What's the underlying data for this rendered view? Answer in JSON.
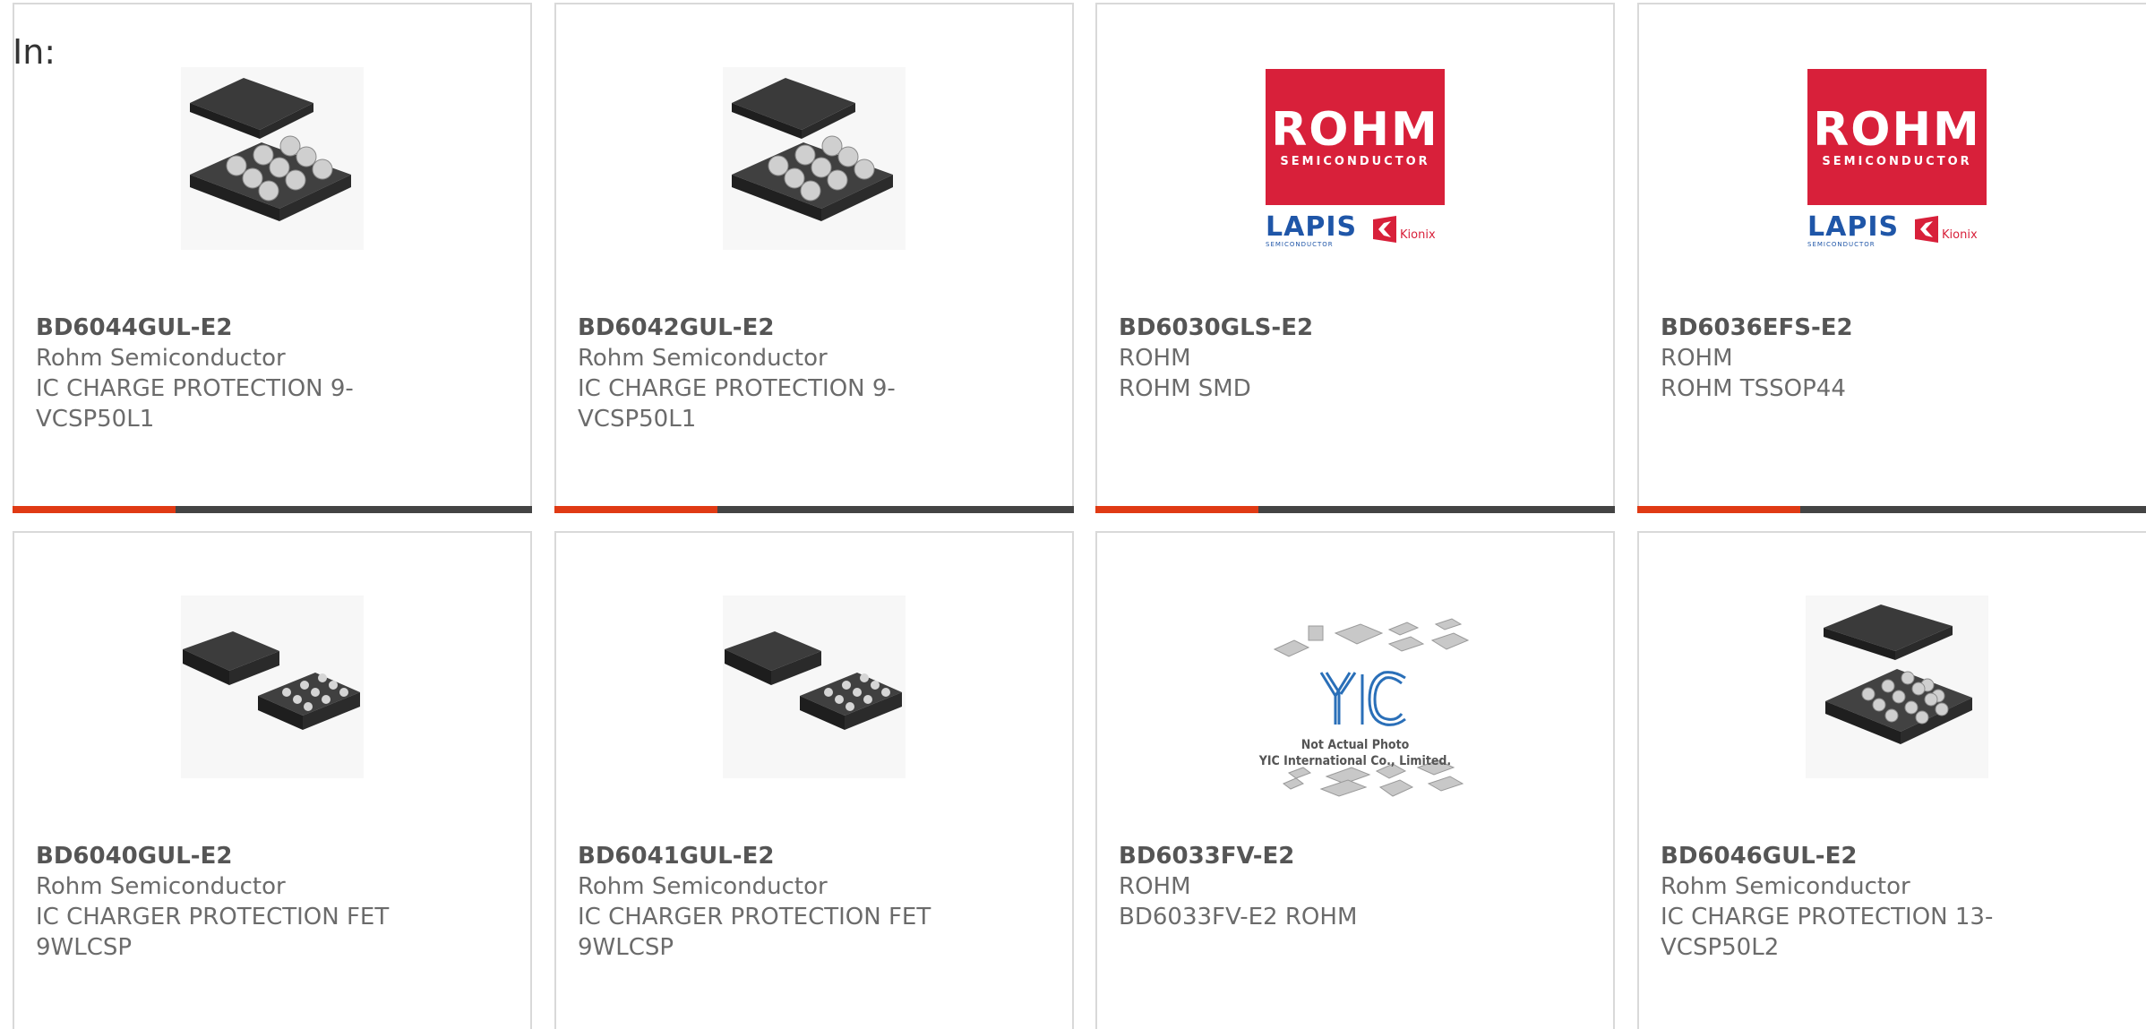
{
  "prefix_label": "In:",
  "colors": {
    "card_border": "#d9d9d9",
    "accent": "#e03a14",
    "bar_dark": "#444444",
    "rohm_red": "#d8203a",
    "lapis_blue": "#1f56a8"
  },
  "cards": [
    {
      "part": "BD6044GUL-E2",
      "manufacturer": "Rohm Semiconductor",
      "description": "IC CHARGE PROTECTION 9-VCSP50L1",
      "image": "bga-chip-9-ball-icon"
    },
    {
      "part": "BD6042GUL-E2",
      "manufacturer": "Rohm Semiconductor",
      "description": "IC CHARGE PROTECTION 9-VCSP50L1",
      "image": "bga-chip-9-ball-icon"
    },
    {
      "part": "BD6030GLS-E2",
      "manufacturer": "ROHM",
      "description": "ROHM SMD",
      "image": "rohm-logo",
      "logo": {
        "title": "ROHM",
        "subtitle": "SEMICONDUCTOR",
        "lapis": "LAPIS",
        "lapis_sub": "SEMICONDUCTOR",
        "kionix": "Kionix"
      }
    },
    {
      "part": "BD6036EFS-E2",
      "manufacturer": "ROHM",
      "description": "ROHM TSSOP44",
      "image": "rohm-logo",
      "logo": {
        "title": "ROHM",
        "subtitle": "SEMICONDUCTOR",
        "lapis": "LAPIS",
        "lapis_sub": "SEMICONDUCTOR",
        "kionix": "Kionix"
      }
    },
    {
      "part": "BD6040GUL-E2",
      "manufacturer": "Rohm Semiconductor",
      "description": "IC CHARGER PROTECTION FET 9WLCSP",
      "image": "wlcsp-chip-pair-icon"
    },
    {
      "part": "BD6041GUL-E2",
      "manufacturer": "Rohm Semiconductor",
      "description": "IC CHARGER PROTECTION FET 9WLCSP",
      "image": "wlcsp-chip-pair-icon"
    },
    {
      "part": "BD6033FV-E2",
      "manufacturer": "ROHM",
      "description": "BD6033FV-E2 ROHM",
      "image": "yic-placeholder",
      "placeholder": {
        "logo": "YIC",
        "line1": "Not Actual Photo",
        "line2": "YIC International Co., Limited."
      }
    },
    {
      "part": "BD6046GUL-E2",
      "manufacturer": "Rohm Semiconductor",
      "description": "IC CHARGE PROTECTION 13-VCSP50L2",
      "image": "bga-chip-13-ball-icon"
    }
  ]
}
